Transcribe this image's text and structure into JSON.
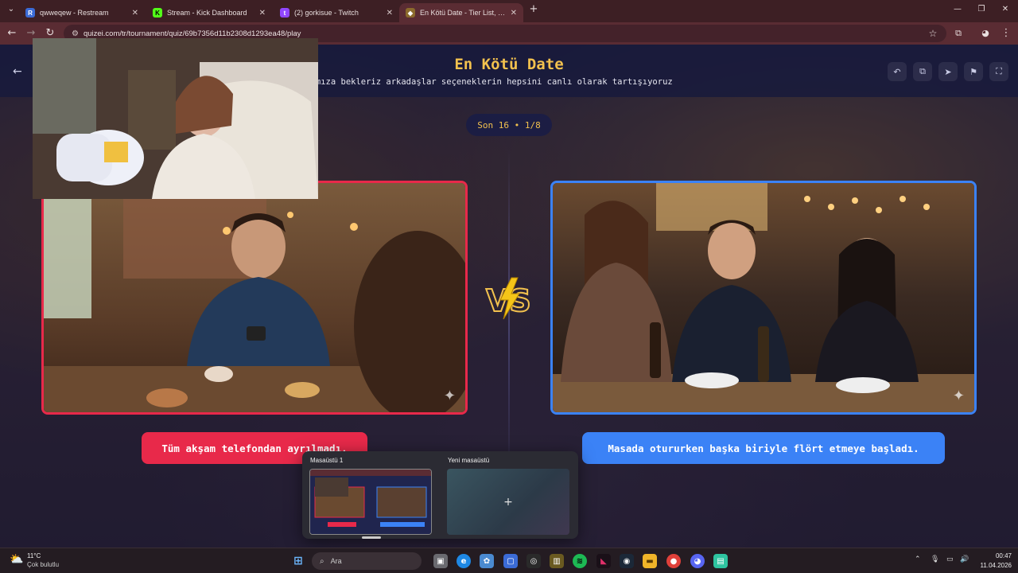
{
  "browser": {
    "tabs": [
      {
        "label": "qwweqew - Restream",
        "favicon": "restream-icon",
        "active": false
      },
      {
        "label": "Stream - Kick Dashboard",
        "favicon": "kick-icon",
        "active": false
      },
      {
        "label": "(2) gorkisue - Twitch",
        "favicon": "twitch-icon",
        "active": false
      },
      {
        "label": "En Kötü Date - Tier List, Kör Sıra",
        "favicon": "quizei-icon",
        "active": true
      }
    ],
    "url": "quizei.com/tr/tournament/quiz/69b7356d11b2308d1293ea48/play"
  },
  "page": {
    "title": "En Kötü Date",
    "subtitle": "if kanalımıza bekleriz arkadaşlar seçeneklerin hepsini canlı olarak tartışıyoruz",
    "round": "Son 16 • 1/8",
    "left_answer": "Tüm akşam telefondan ayrılmadı.",
    "right_answer": "Masada otururken başka biriyle flört etmeye başladı."
  },
  "taskview": {
    "desktop1_label": "Masaüstü 1",
    "new_desktop_label": "Yeni masaüstü",
    "plus": "+"
  },
  "taskbar": {
    "temperature": "11°C",
    "weather": "Çok bulutlu",
    "search_placeholder": "Ara",
    "time": "00:47",
    "date": "11.04.2026"
  },
  "colors": {
    "accent_gold": "#f2c14e",
    "left_red": "#e8294a",
    "right_blue": "#3b82f6"
  }
}
